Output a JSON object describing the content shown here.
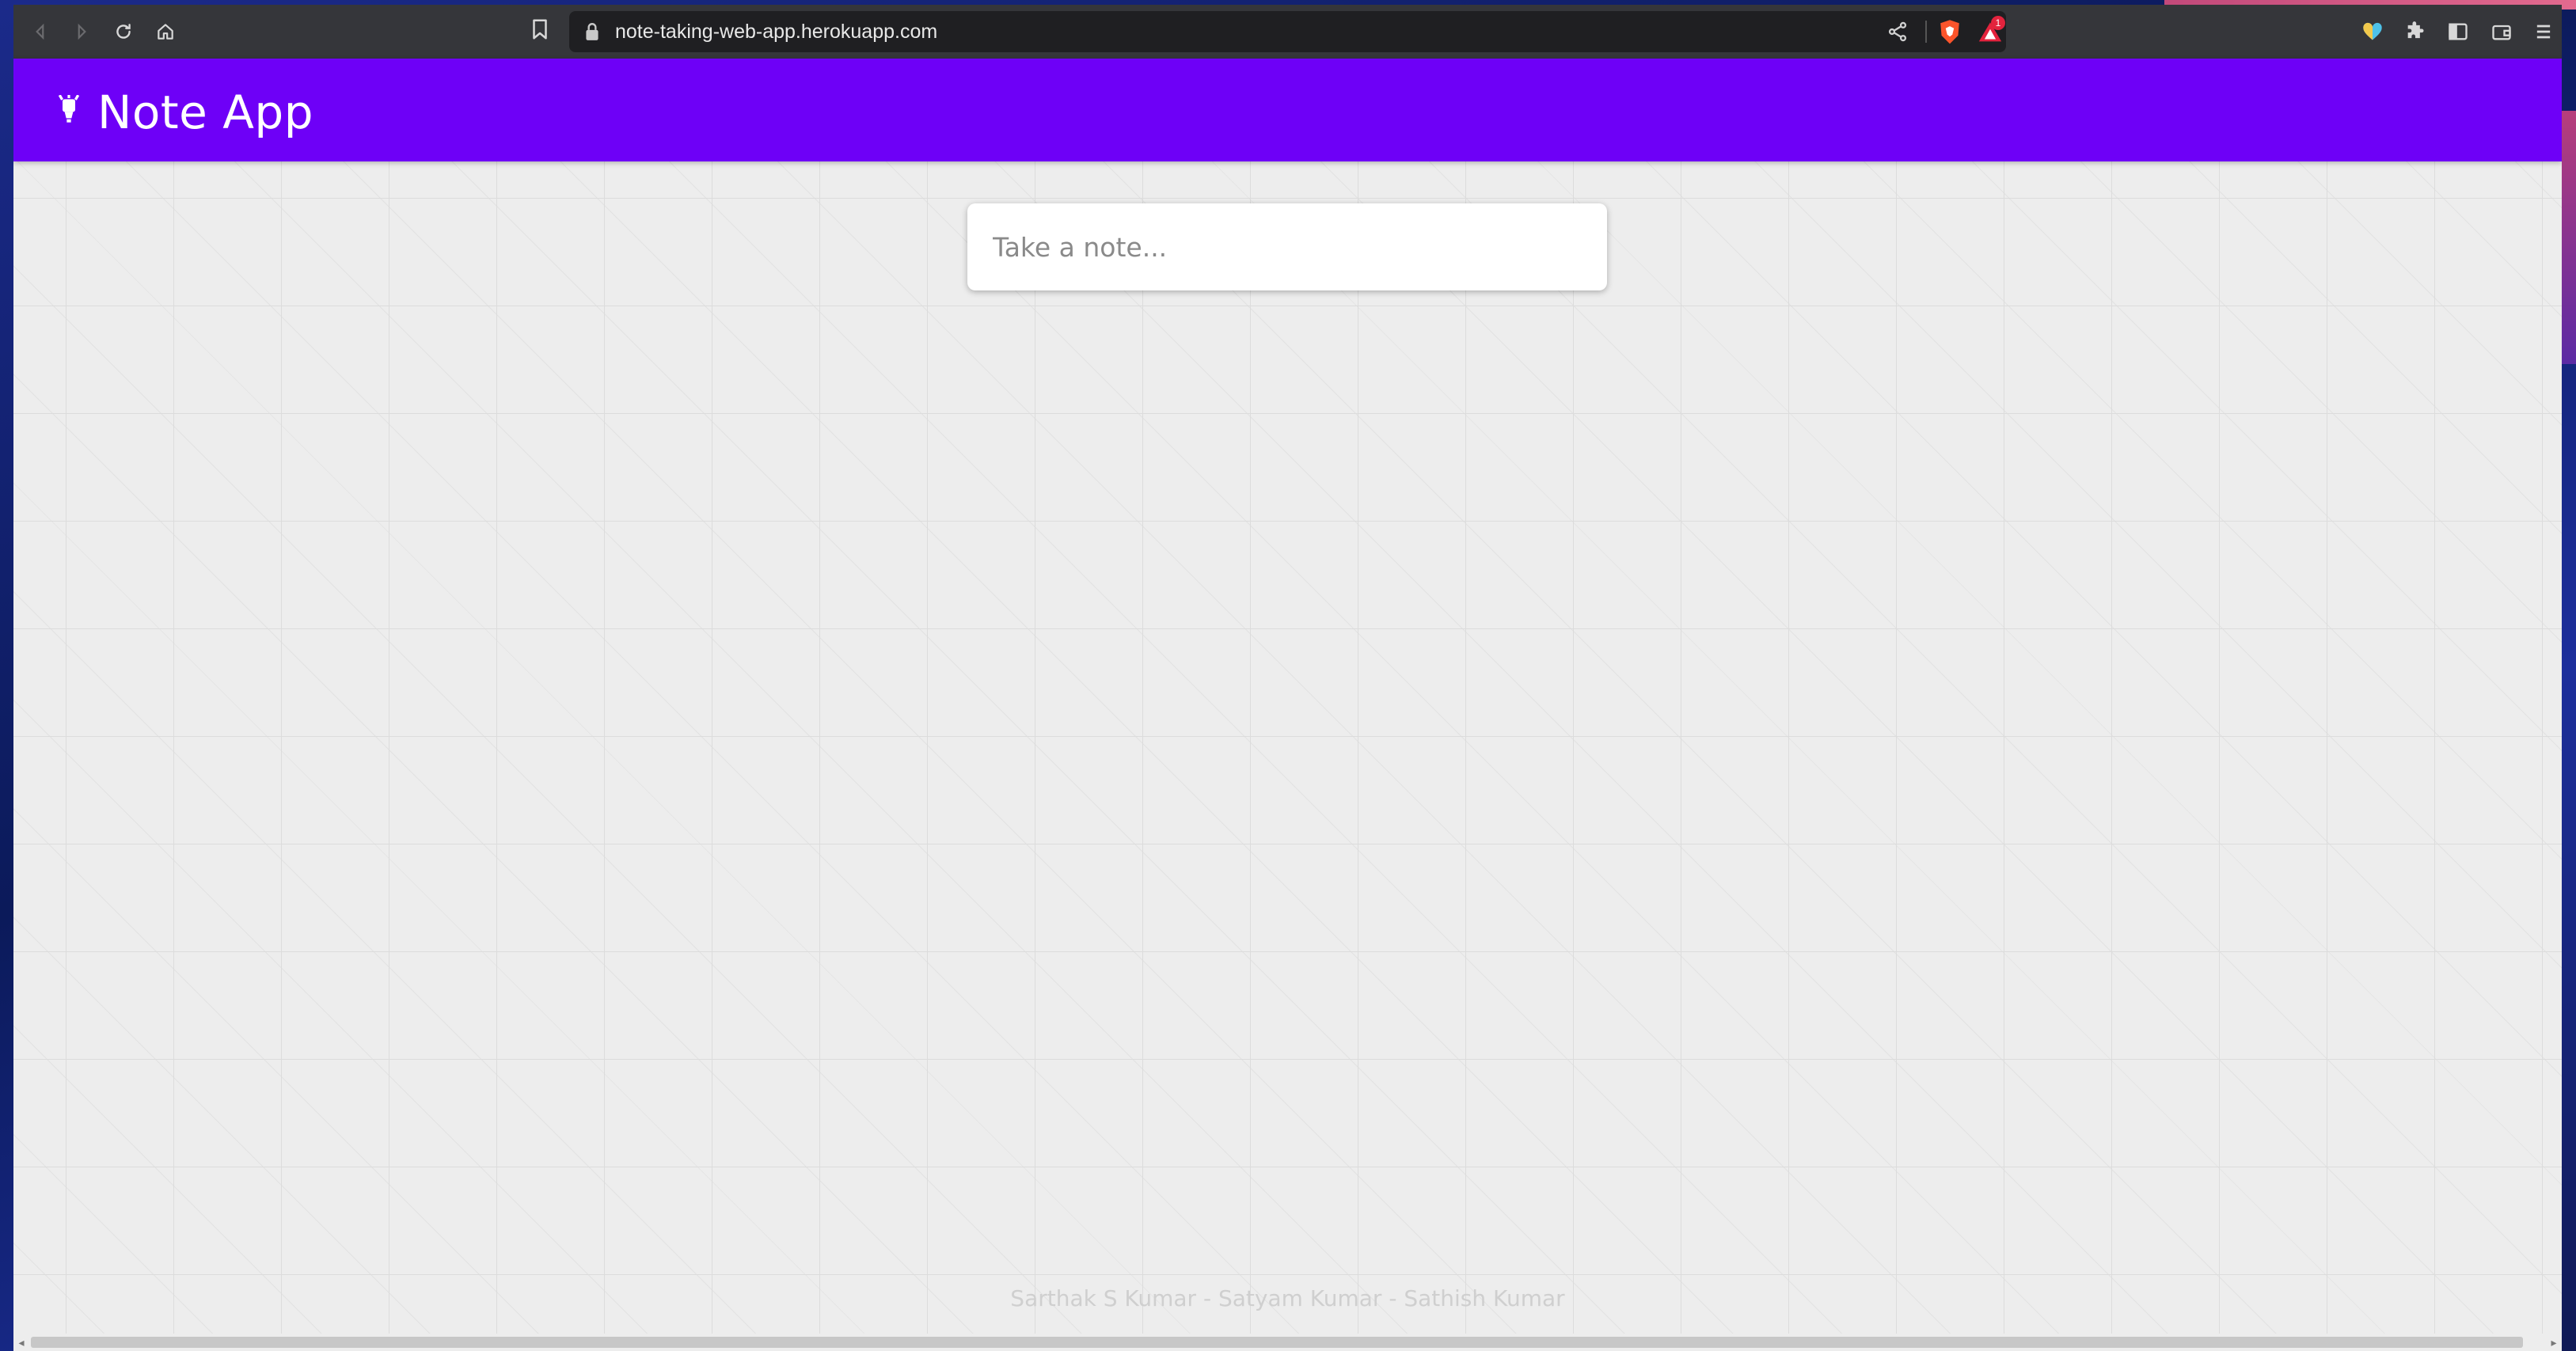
{
  "browser": {
    "url": "note-taking-web-app.herokuapp.com",
    "rewards_badge": "1"
  },
  "app": {
    "title": "Note App",
    "icon": "lightbulb-icon",
    "brand_color": "#6e00f7"
  },
  "note_input": {
    "placeholder": "Take a note..."
  },
  "footer": {
    "credits": "Sarthak S Kumar - Satyam Kumar - Sathish Kumar"
  }
}
